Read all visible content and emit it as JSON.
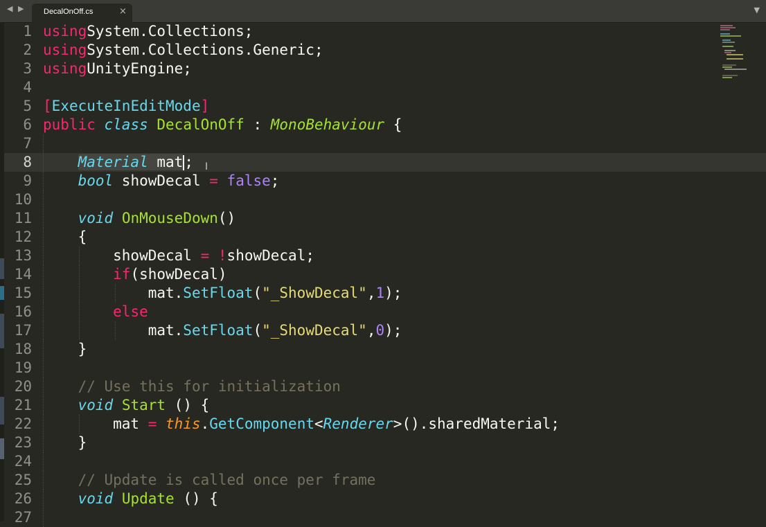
{
  "window": {
    "nav_arrows": "◀ ▶",
    "tab": {
      "label": "DecalOnOff.cs",
      "close": "×"
    },
    "dropdown_icon": "▼"
  },
  "theme": {
    "background": "#272822",
    "keyword": "#f92672",
    "storage": "#66d9ef",
    "class_name": "#a6e22e",
    "string": "#e6db74",
    "number": "#ae81ff",
    "comment": "#75715e",
    "this": "#fd971f"
  },
  "editor": {
    "current_line": 8,
    "lines": [
      {
        "n": "1",
        "t": [
          [
            "kw",
            "using"
          ],
          [
            "",
            "System.Collections;"
          ]
        ]
      },
      {
        "n": "2",
        "t": [
          [
            "kw",
            "using"
          ],
          [
            "",
            "System.Collections.Generic;"
          ]
        ]
      },
      {
        "n": "3",
        "t": [
          [
            "kw",
            "using"
          ],
          [
            "",
            "UnityEngine;"
          ]
        ]
      },
      {
        "n": "4",
        "t": []
      },
      {
        "n": "5",
        "t": [
          [
            "brk",
            "["
          ],
          [
            "attr",
            "ExecuteInEditMode"
          ],
          [
            "brk",
            "]"
          ]
        ]
      },
      {
        "n": "6",
        "t": [
          [
            "kw",
            "public"
          ],
          [
            "",
            " "
          ],
          [
            "sto",
            "class"
          ],
          [
            "",
            " "
          ],
          [
            "cls",
            "DecalOnOff"
          ],
          [
            "",
            " : "
          ],
          [
            "inh",
            "MonoBehaviour"
          ],
          [
            "",
            " {"
          ]
        ]
      },
      {
        "n": "7",
        "t": []
      },
      {
        "n": "8",
        "t": [
          [
            "",
            "    "
          ],
          [
            "sto sel",
            "Material"
          ],
          [
            "sel",
            " mat"
          ],
          [
            "caret",
            ""
          ],
          [
            "",
            ";"
          ]
        ]
      },
      {
        "n": "9",
        "t": [
          [
            "",
            "    "
          ],
          [
            "sto",
            "bool"
          ],
          [
            "",
            " showDecal "
          ],
          [
            "op",
            "="
          ],
          [
            "",
            " "
          ],
          [
            "lit",
            "false"
          ],
          [
            "",
            ";"
          ]
        ]
      },
      {
        "n": "10",
        "t": []
      },
      {
        "n": "11",
        "t": [
          [
            "",
            "    "
          ],
          [
            "sto",
            "void"
          ],
          [
            "",
            " "
          ],
          [
            "fn",
            "OnMouseDown"
          ],
          [
            "",
            "()"
          ]
        ]
      },
      {
        "n": "12",
        "t": [
          [
            "",
            "    {"
          ]
        ]
      },
      {
        "n": "13",
        "t": [
          [
            "",
            "        showDecal "
          ],
          [
            "op",
            "="
          ],
          [
            "",
            " "
          ],
          [
            "op",
            "!"
          ],
          [
            "",
            "showDecal;"
          ]
        ]
      },
      {
        "n": "14",
        "t": [
          [
            "",
            "        "
          ],
          [
            "kw",
            "if"
          ],
          [
            "",
            "(showDecal)"
          ]
        ]
      },
      {
        "n": "15",
        "t": [
          [
            "",
            "            mat."
          ],
          [
            "call",
            "SetFloat"
          ],
          [
            "",
            "("
          ],
          [
            "str",
            "\"_ShowDecal\""
          ],
          [
            "",
            ","
          ],
          [
            "num",
            "1"
          ],
          [
            "",
            ");"
          ]
        ]
      },
      {
        "n": "16",
        "t": [
          [
            "",
            "        "
          ],
          [
            "kw",
            "else"
          ]
        ]
      },
      {
        "n": "17",
        "t": [
          [
            "",
            "            mat."
          ],
          [
            "call",
            "SetFloat"
          ],
          [
            "",
            "("
          ],
          [
            "str",
            "\"_ShowDecal\""
          ],
          [
            "",
            ","
          ],
          [
            "num",
            "0"
          ],
          [
            "",
            ");"
          ]
        ]
      },
      {
        "n": "18",
        "t": [
          [
            "",
            "    }"
          ]
        ]
      },
      {
        "n": "19",
        "t": []
      },
      {
        "n": "20",
        "t": [
          [
            "",
            "    "
          ],
          [
            "cmt",
            "// Use this for initialization"
          ]
        ]
      },
      {
        "n": "21",
        "t": [
          [
            "",
            "    "
          ],
          [
            "sto",
            "void"
          ],
          [
            "",
            " "
          ],
          [
            "fn",
            "Start"
          ],
          [
            "",
            " () {"
          ]
        ]
      },
      {
        "n": "22",
        "t": [
          [
            "",
            "        mat "
          ],
          [
            "op",
            "="
          ],
          [
            "",
            " "
          ],
          [
            "self",
            "this"
          ],
          [
            "",
            "."
          ],
          [
            "call",
            "GetComponent"
          ],
          [
            "",
            "<"
          ],
          [
            "sto",
            "Renderer"
          ],
          [
            "",
            ">().sharedMaterial;"
          ]
        ]
      },
      {
        "n": "23",
        "t": [
          [
            "",
            "    }"
          ]
        ]
      },
      {
        "n": "24",
        "t": []
      },
      {
        "n": "25",
        "t": [
          [
            "",
            "    "
          ],
          [
            "cmt",
            "// Update is called once per frame"
          ]
        ]
      },
      {
        "n": "26",
        "t": [
          [
            "",
            "    "
          ],
          [
            "sto",
            "void"
          ],
          [
            "",
            " "
          ],
          [
            "fn",
            "Update"
          ],
          [
            "",
            " () {"
          ]
        ]
      },
      {
        "n": "27",
        "t": []
      }
    ]
  }
}
